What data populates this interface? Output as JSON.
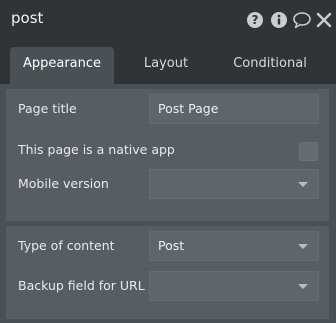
{
  "header": {
    "title": "post",
    "icons": [
      "help-icon",
      "info-icon",
      "comment-icon",
      "close-icon"
    ]
  },
  "tabs": [
    {
      "label": "Appearance",
      "active": true
    },
    {
      "label": "Layout",
      "active": false
    },
    {
      "label": "Conditional",
      "active": false
    }
  ],
  "appearance": {
    "page_title_label": "Page title",
    "page_title_value": "Post Page",
    "native_app_label": "This page is a native app",
    "native_app_checked": false,
    "mobile_version_label": "Mobile version",
    "mobile_version_value": "",
    "type_of_content_label": "Type of content",
    "type_of_content_value": "Post",
    "backup_field_label": "Backup field for URL",
    "backup_field_value": ""
  },
  "colors": {
    "header_bg": "#2f3438",
    "panel_bg": "#4a5156",
    "section_bg": "#575e63",
    "field_bg": "#5f666b"
  }
}
